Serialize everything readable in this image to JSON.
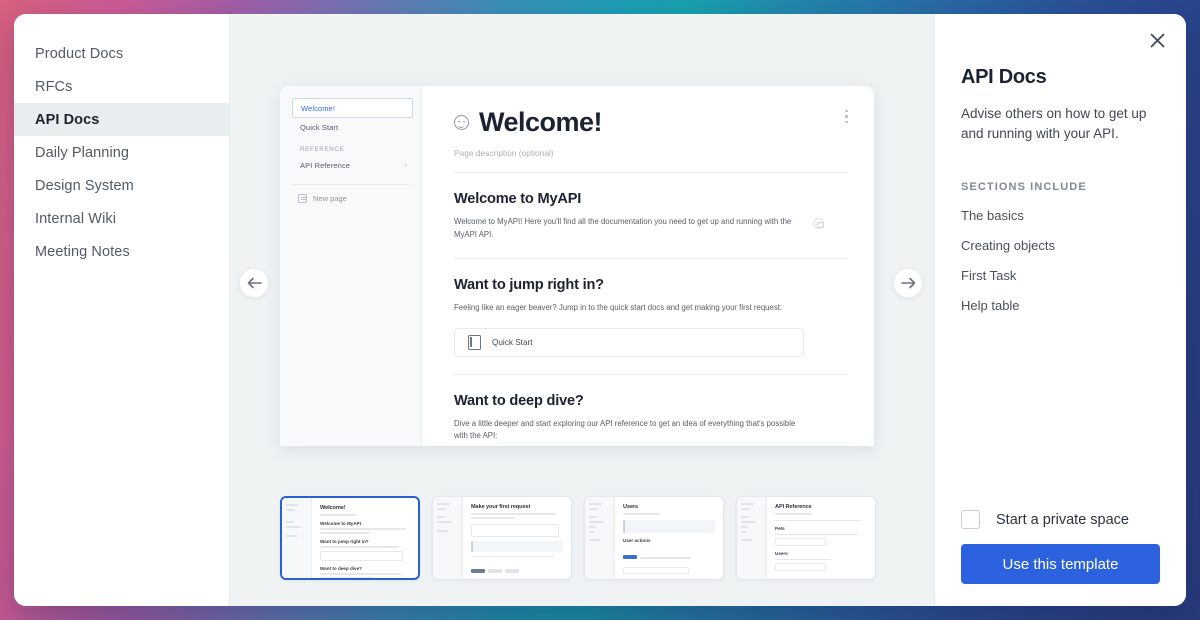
{
  "sidebar": {
    "items": [
      {
        "label": "Product Docs",
        "active": false
      },
      {
        "label": "RFCs",
        "active": false
      },
      {
        "label": "API Docs",
        "active": true
      },
      {
        "label": "Daily Planning",
        "active": false
      },
      {
        "label": "Design System",
        "active": false
      },
      {
        "label": "Internal Wiki",
        "active": false
      },
      {
        "label": "Meeting Notes",
        "active": false
      }
    ]
  },
  "preview": {
    "mini_sidebar": {
      "selected_page": "Welcome!",
      "pages": [
        "Quick Start"
      ],
      "caption": "REFERENCE",
      "reference_item": "API Reference",
      "new_page": "New page"
    },
    "doc": {
      "emoji": "smiley-face-icon",
      "title": "Welcome!",
      "description_placeholder": "Page description (optional)",
      "section1_heading": "Welcome to MyAPI",
      "section1_body": "Welcome to MyAPI! Here you'll find all the documentation you need to get up and running with the MyAPI API.",
      "section2_heading": "Want to jump right in?",
      "section2_body": "Feeling like an eager beaver? Jump in to the quick start docs and get making your first request:",
      "quick_start_card": "Quick Start",
      "section3_heading": "Want to deep dive?",
      "section3_body": "Dive a little deeper and start exploring our API reference to get an idea of everything that's possible with the API:"
    },
    "nav": {
      "prev": "previous-page",
      "next": "next-page"
    }
  },
  "thumbnails": [
    {
      "title": "Welcome!",
      "selected": true,
      "headings": [
        "Welcome to MyAPI",
        "Want to jump right in?",
        "Want to deep dive?"
      ]
    },
    {
      "title": "Make your first request",
      "selected": false,
      "headings": []
    },
    {
      "title": "Users",
      "selected": false,
      "headings": [
        "User actions"
      ]
    },
    {
      "title": "API Reference",
      "selected": false,
      "headings": [
        "Pets",
        "Users"
      ]
    }
  ],
  "right_panel": {
    "close_icon": "close-icon",
    "title": "API Docs",
    "description": "Advise others on how to get up and running with your API.",
    "sections_caption": "SECTIONS INCLUDE",
    "sections": [
      "The basics",
      "Creating objects",
      "First Task",
      "Help table"
    ],
    "private_label": "Start a private space",
    "private_checked": false,
    "cta_label": "Use this template",
    "cta_color": "#2c62e0"
  }
}
